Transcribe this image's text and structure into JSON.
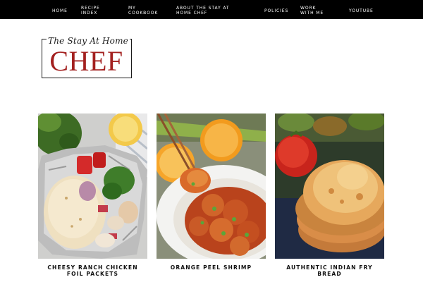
{
  "nav": {
    "items": [
      {
        "label": "HOME"
      },
      {
        "label": "RECIPE INDEX"
      },
      {
        "label": "MY COOKBOOK"
      },
      {
        "label": "ABOUT THE STAY AT HOME CHEF"
      },
      {
        "label": "POLICIES"
      },
      {
        "label": "WORK WITH ME"
      },
      {
        "label": "YOUTUBE"
      }
    ]
  },
  "logo": {
    "script_text": "The Stay At Home",
    "main_text": "CHEF",
    "accent_color": "#a3201f"
  },
  "recipes": [
    {
      "title": "CHEESY RANCH CHICKEN FOIL PACKETS",
      "image": "foil-packet-chicken-photo"
    },
    {
      "title": "ORANGE PEEL SHRIMP",
      "image": "orange-peel-shrimp-photo"
    },
    {
      "title": "AUTHENTIC INDIAN FRY BREAD",
      "image": "fry-bread-photo"
    }
  ]
}
